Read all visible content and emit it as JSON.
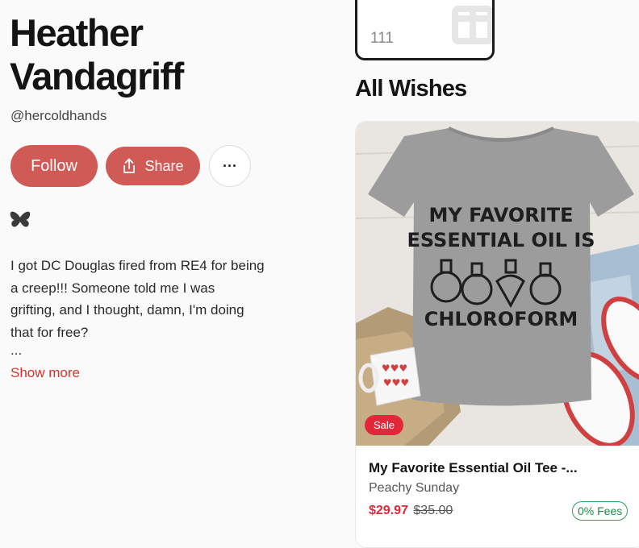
{
  "profile": {
    "name": "Heather Vandagriff",
    "handle": "@hercoldhands",
    "follow_label": "Follow",
    "share_label": "Share",
    "more_label": "···",
    "social_icon": "butterfly-icon",
    "bio": "I got DC Douglas fired from RE4 for being\na creep!!! Someone told me I was\ngrifting, and I thought, damn, I'm doing\nthat for free?",
    "ellipsis": "...",
    "show_more": "Show more"
  },
  "wishlist_card": {
    "count": "111",
    "icon": "gift-icon"
  },
  "section": {
    "title": "All Wishes"
  },
  "wish": {
    "shirt_text_line1": "MY FAVORITE",
    "shirt_text_line2": "ESSENTIAL OIL IS",
    "shirt_text_line3": "CHLOROFORM",
    "sale_badge": "Sale",
    "title": "My Favorite Essential Oil Tee -...",
    "brand": "Peachy Sunday",
    "price_sale": "$29.97",
    "price_original": "$35.00",
    "fees_badge": "0% Fees"
  },
  "colors": {
    "accent": "#d05a55",
    "sale_red": "#e3263a",
    "link_red": "#e0302c",
    "fees_green": "#1f8a4c"
  }
}
